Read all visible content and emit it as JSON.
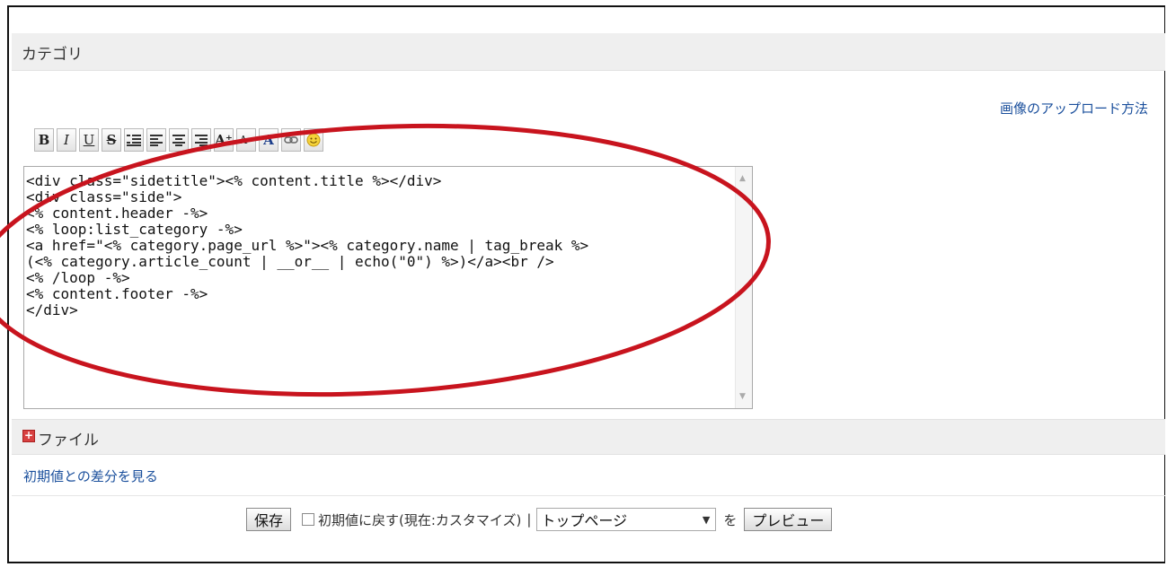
{
  "header": {
    "title": "カテゴリ"
  },
  "upload_link": "画像のアップロード方法",
  "toolbar": {
    "buttons": [
      {
        "icon": "bold-icon",
        "glyph": "B"
      },
      {
        "icon": "italic-icon",
        "glyph": "I"
      },
      {
        "icon": "underline-icon",
        "glyph": "U"
      },
      {
        "icon": "strikethrough-icon",
        "glyph": "S"
      },
      {
        "icon": "blockquote-icon",
        "glyph": ""
      },
      {
        "icon": "align-left-icon",
        "glyph": ""
      },
      {
        "icon": "align-center-icon",
        "glyph": ""
      },
      {
        "icon": "align-right-icon",
        "glyph": ""
      },
      {
        "icon": "font-size-up-icon",
        "glyph": "A⁺"
      },
      {
        "icon": "font-size-down-icon",
        "glyph": "A⁻"
      },
      {
        "icon": "font-color-icon",
        "glyph": "A"
      },
      {
        "icon": "link-icon",
        "glyph": ""
      },
      {
        "icon": "emoticon-icon",
        "glyph": ""
      }
    ]
  },
  "editor": {
    "content": "<div class=\"sidetitle\"><% content.title %></div>\n<div class=\"side\">\n<% content.header -%>\n<% loop:list_category -%>\n<a href=\"<% category.page_url %>\"><% category.name | tag_break %>\n(<% category.article_count | __or__ | echo(\"0\") %>)</a><br />\n<% /loop -%>\n<% content.footer -%>\n</div>"
  },
  "file_section": {
    "title": "ファイル"
  },
  "diff_link": "初期値との差分を見る",
  "actions": {
    "save_label": "保存",
    "reset_label": "初期値に戻す(現在:カスタマイズ)",
    "separator": "|",
    "select_value": "トップページ",
    "wo": "を",
    "preview_label": "プレビュー"
  },
  "colors": {
    "annotation_ellipse": "#c8141e",
    "link": "#1a4f9c",
    "bar_bg": "#efefef"
  }
}
